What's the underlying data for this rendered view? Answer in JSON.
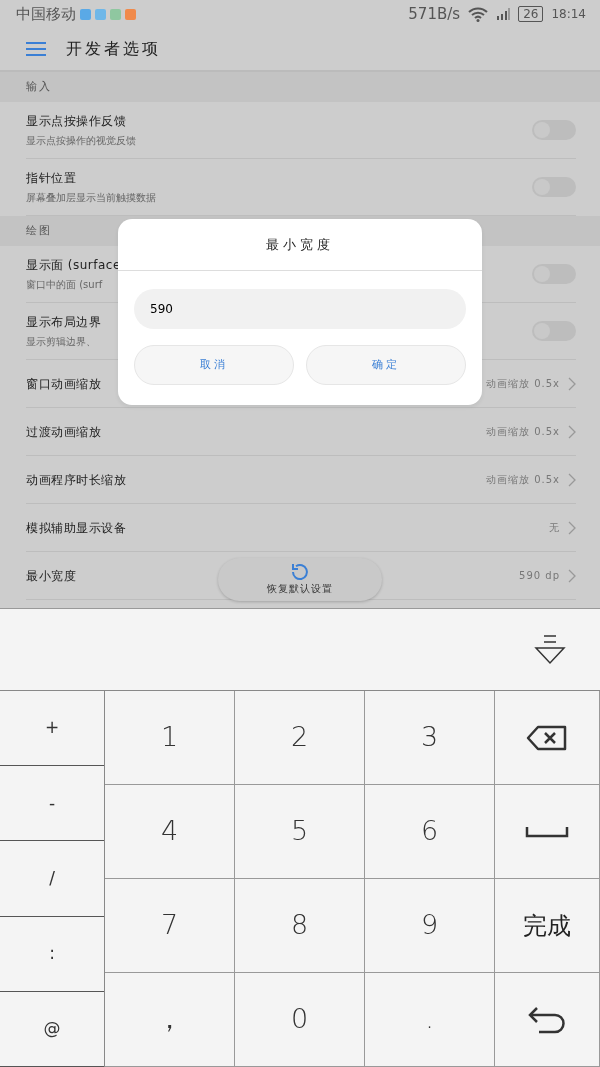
{
  "status_bar": {
    "carrier": "中国移动",
    "speed": "571B/s",
    "battery": "26",
    "time": "18:14"
  },
  "app_bar": {
    "title": "开发者选项"
  },
  "sections": [
    {
      "header": "输入",
      "items": [
        {
          "kind": "toggle",
          "title": "显示点按操作反馈",
          "subtitle": "显示点按操作的视觉反馈",
          "on": false
        },
        {
          "kind": "toggle",
          "title": "指针位置",
          "subtitle": "屏幕叠加层显示当前触摸数据",
          "on": false
        }
      ]
    },
    {
      "header": "绘图",
      "items": [
        {
          "kind": "toggle",
          "title": "显示面 (surface",
          "subtitle": "窗口中的面 (surf",
          "on": false
        },
        {
          "kind": "toggle",
          "title": "显示布局边界",
          "subtitle": "显示剪辑边界、",
          "on": false
        },
        {
          "kind": "link",
          "title": "窗口动画缩放",
          "value": "动画缩放 0.5x"
        },
        {
          "kind": "link",
          "title": "过渡动画缩放",
          "value": "动画缩放 0.5x"
        },
        {
          "kind": "link",
          "title": "动画程序时长缩放",
          "value": "动画缩放 0.5x"
        },
        {
          "kind": "link",
          "title": "模拟辅助显示设备",
          "value": "无"
        },
        {
          "kind": "link",
          "title": "最小宽度",
          "value": "590 dp"
        }
      ]
    }
  ],
  "restore_button": {
    "label": "恢复默认设置"
  },
  "dialog": {
    "title": "最小宽度",
    "value": "590",
    "buttons": [
      "取消",
      "确定"
    ]
  },
  "keyboard": {
    "side_keys": [
      "+",
      "-",
      "/",
      ":",
      "@"
    ],
    "keys": [
      {
        "kind": "text",
        "label": "1"
      },
      {
        "kind": "text",
        "label": "2"
      },
      {
        "kind": "text",
        "label": "3"
      },
      {
        "kind": "backspace"
      },
      {
        "kind": "text",
        "label": "4"
      },
      {
        "kind": "text",
        "label": "5"
      },
      {
        "kind": "text",
        "label": "6"
      },
      {
        "kind": "space"
      },
      {
        "kind": "text",
        "label": "7"
      },
      {
        "kind": "text",
        "label": "8"
      },
      {
        "kind": "text",
        "label": "9"
      },
      {
        "kind": "done",
        "label": "完成"
      },
      {
        "kind": "text",
        "label": "，"
      },
      {
        "kind": "text",
        "label": "0"
      },
      {
        "kind": "text",
        "label": "."
      },
      {
        "kind": "enter"
      }
    ]
  }
}
